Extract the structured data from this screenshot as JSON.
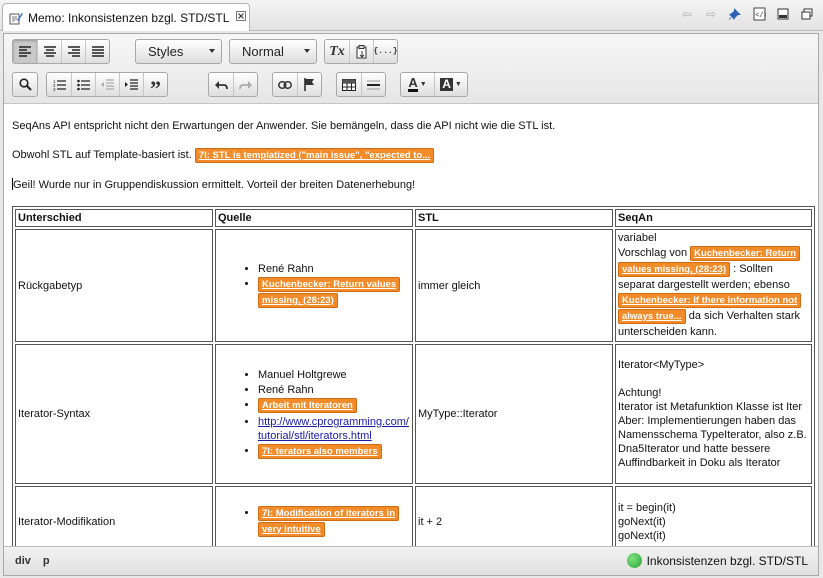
{
  "tab": {
    "title": "Memo: Inkonsistenzen bzgl. STD/STL",
    "icon": "memo-edit-icon",
    "close_icon": "close-icon"
  },
  "window_icons": [
    "back-arrow-icon",
    "forward-arrow-icon",
    "pin-icon",
    "source-icon",
    "minimize-icon",
    "maximize-icon"
  ],
  "toolbar": {
    "styles_label": "Styles",
    "format_label": "Normal",
    "row1": [
      "align-left-icon",
      "align-center-icon",
      "align-right-icon",
      "align-justify-icon"
    ],
    "format_buttons": [
      "remove-format-icon",
      "paste-icon",
      "source-code-icon"
    ],
    "format_glyphs": {
      "remove_format": "Tx",
      "source": "{...}"
    },
    "row2": [
      "find-icon",
      "numbered-list-icon",
      "bulleted-list-icon",
      "outdent-icon",
      "indent-icon",
      "blockquote-icon",
      "undo-icon",
      "redo-icon",
      "link-icon",
      "anchor-flag-icon",
      "table-icon",
      "horizontal-rule-icon",
      "text-color-icon",
      "background-color-icon"
    ],
    "text_color_glyph": "A",
    "bg_color_glyph": "A"
  },
  "content": {
    "p1": "SeqAns API entspricht nicht den Erwartungen der Anwender. Sie bemängeln, dass die API nicht wie die STL ist.",
    "p2": "Obwohl STL auf Template-basiert ist. ",
    "p2_comment": "7l: STL is templatized (\"main issue\", \"expected to...",
    "p3": "Geil! Wurde nur in Gruppendiskussion ermittelt. Vorteil der breiten Datenerhebung!",
    "table": {
      "headers": [
        "Unterschied",
        "Quelle",
        "STL",
        "SeqAn"
      ],
      "rows": [
        {
          "label": "Rückgabetyp",
          "sources": [
            {
              "text": "René Rahn"
            },
            {
              "comment": "Kuchenbecker: Return values missing, (28:23)"
            }
          ],
          "stl": "immer gleich",
          "seqan": {
            "line1": "variabel",
            "line2": "Vorschlag von ",
            "comment1": "Kuchenbecker: Return values missing, (28:23)",
            "text2": " : Sollten separat dargestellt werden; ebenso ",
            "comment2": "Kuchenbecker: If there information not always true...",
            "text3": " da sich Verhalten stark unterscheiden kann."
          }
        },
        {
          "label": "Iterator-Syntax",
          "sources": [
            {
              "text": "Manuel Holtgrewe"
            },
            {
              "text": "René Rahn"
            },
            {
              "comment": "Arbeit mit Iteratoren"
            },
            {
              "link": "http://www.cprogramming.com/ tutorial/stl/iterators.html"
            },
            {
              "comment": "7l: terators also members"
            }
          ],
          "stl": "MyType::Iterator",
          "seqan": {
            "line1": "Iterator<MyType>",
            "line2": "Achtung!",
            "line3": "Iterator ist Metafunktion Klasse ist Iter",
            "line4": "Aber: Implementierungen haben das Namensschema TypeIterator, also z.B. Dna5Iterator und hatte bessere Auffindbarkeit in Doku als Iterator"
          }
        },
        {
          "label": "Iterator-Modifikation",
          "sources": [
            {
              "comment": "7l: Modification of iterators in very intuitive"
            }
          ],
          "stl": "it + 2",
          "seqan": {
            "line1": "it = begin(it)",
            "line2": "goNext(it)",
            "line3": "goNext(it)"
          }
        }
      ]
    }
  },
  "statusbar": {
    "path": [
      "div",
      "p"
    ],
    "right_label": "Inkonsistenzen bzgl. STD/STL",
    "status_color": "#2fb33a"
  },
  "colors": {
    "comment_bg": "#f28c2a",
    "link": "#1a1aa6"
  }
}
